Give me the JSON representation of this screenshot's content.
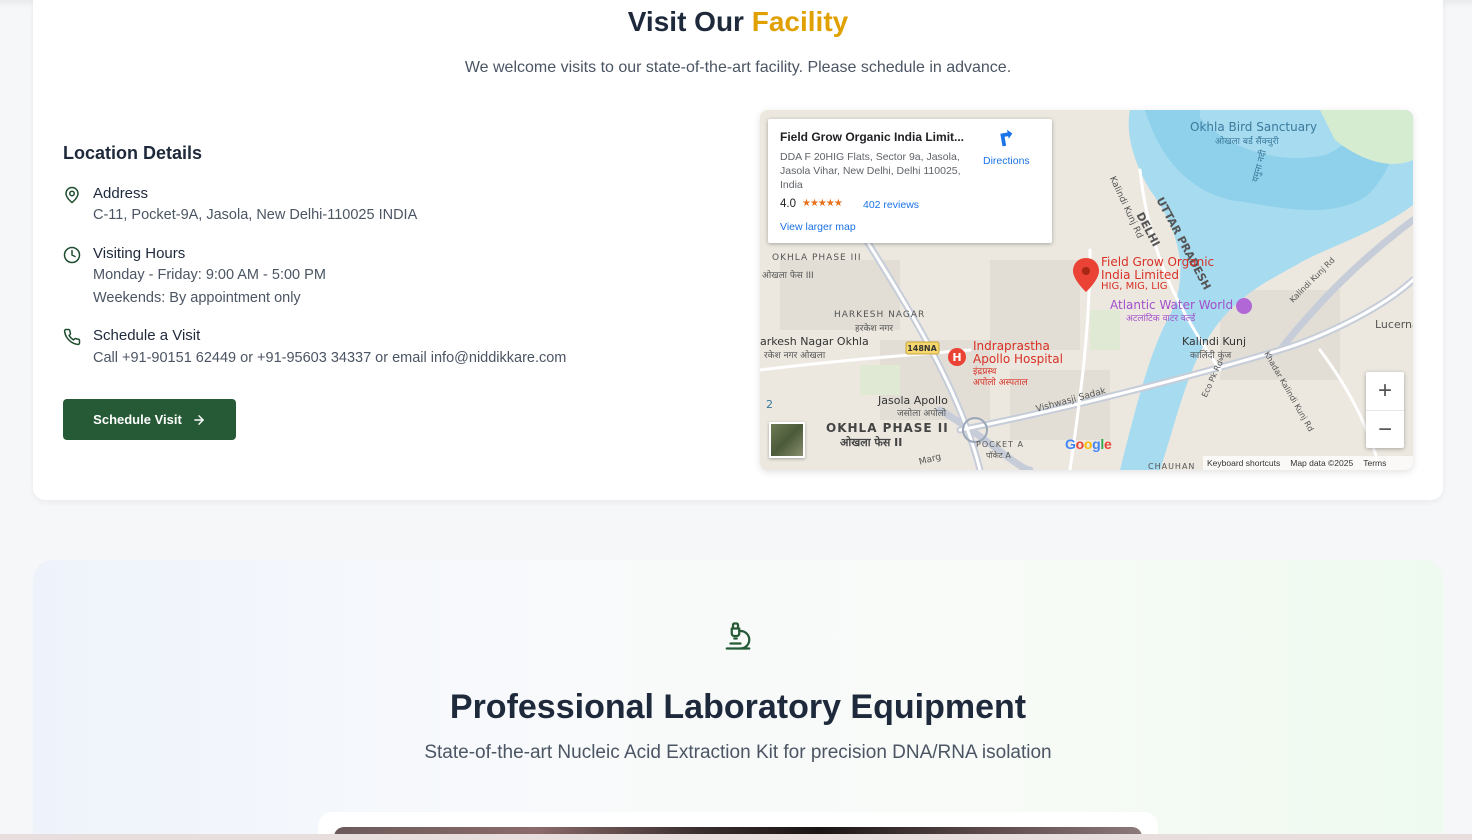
{
  "facility": {
    "title_main": "Visit Our",
    "title_accent": "Facility",
    "subtitle": "We welcome visits to our state-of-the-art facility. Please schedule in advance.",
    "location_heading": "Location Details",
    "address_title": "Address",
    "address_line": "C-11, Pocket-9A, Jasola, New Delhi-110025 INDIA",
    "hours_title": "Visiting Hours",
    "hours_line1": "Monday - Friday: 9:00 AM - 5:00 PM",
    "hours_line2": "Weekends: By appointment only",
    "schedule_title": "Schedule a Visit",
    "schedule_line": "Call +91-90151 62449 or +91-95603 34337 or email info@niddikkare.com",
    "button_label": "Schedule Visit"
  },
  "map": {
    "place_name": "Field Grow Organic India Limit...",
    "place_address": "DDA F 20HIG Flats, Sector 9a, Jasola, Jasola Vihar, New Delhi, Delhi 110025, India",
    "rating": "4.0",
    "stars": "★★★★★",
    "reviews": "402 reviews",
    "view_larger": "View larger map",
    "directions": "Directions",
    "zoom_in": "+",
    "zoom_out": "−",
    "keyboard": "Keyboard shortcuts",
    "map_data": "Map data ©2025",
    "terms": "Terms",
    "labels": {
      "okhla_bird": "Okhla Bird Sanctuary",
      "okhla_bird_hi": "ओखला बर्ड सैंक्चुरी",
      "uttar_pradesh": "UTTAR PRADESH",
      "delhi": "DELHI",
      "kalindi_kunj_rd": "Kalindi Kunj Rd",
      "marker_line1": "Field Grow Organic",
      "marker_line2": "India Limited",
      "marker_line3": "HIG, MIG, LIG",
      "atlantic": "Atlantic Water World",
      "atlantic_hi": "अटलांटिक वाटर वर्ल्ड",
      "lucerna": "Lucerna",
      "kalindi_kunj": "Kalindi Kunj",
      "kalindi_kunj_hi": "कालिंदी कुंज",
      "okhla_phase3": "OKHLA PHASE III",
      "okhla_phase3_hi": "ओखला फेस III",
      "harkesh": "HARKESH NAGAR",
      "harkesh_hi": "हरकेश नगर",
      "harkesh_okhla": "arkesh Nagar Okhla",
      "harkesh_okhla_hi": "रकेश नगर ओखला",
      "road_148na": "148NA",
      "apollo_line1": "Indraprastha",
      "apollo_line2": "Apollo Hospital",
      "apollo_hi1": "इंद्रप्रस्थ",
      "apollo_hi2": "अपोलो अस्पताल",
      "vishwasji": "Vishwasji Sadak",
      "jasola_apollo": "Jasola Apollo",
      "jasola_apollo_hi": "जसोला अपोलो",
      "okhla_phase2": "OKHLA PHASE II",
      "okhla_phase2_hi": "ओखला फेस II",
      "pocket_a": "POCKET A",
      "pocket_a_hi": "पॉकेट A",
      "eco_pk": "Eco Pk Rd",
      "kalindi_kunj_rd2": "Kalindi Kunj Rd",
      "khadar": "Khadar Kalindi Kunj Rd",
      "chauhan": "CHAUHAN",
      "marg": "Marg",
      "yamuna_hi": "यमुना नदी",
      "num_2": "2"
    }
  },
  "equipment": {
    "title": "Professional Laboratory Equipment",
    "subtitle": "State-of-the-art Nucleic Acid Extraction Kit for precision DNA/RNA isolation"
  },
  "colors": {
    "primary": "#265a36",
    "accent": "#e0a100",
    "heading": "#1e293b",
    "body": "#4b5563"
  }
}
